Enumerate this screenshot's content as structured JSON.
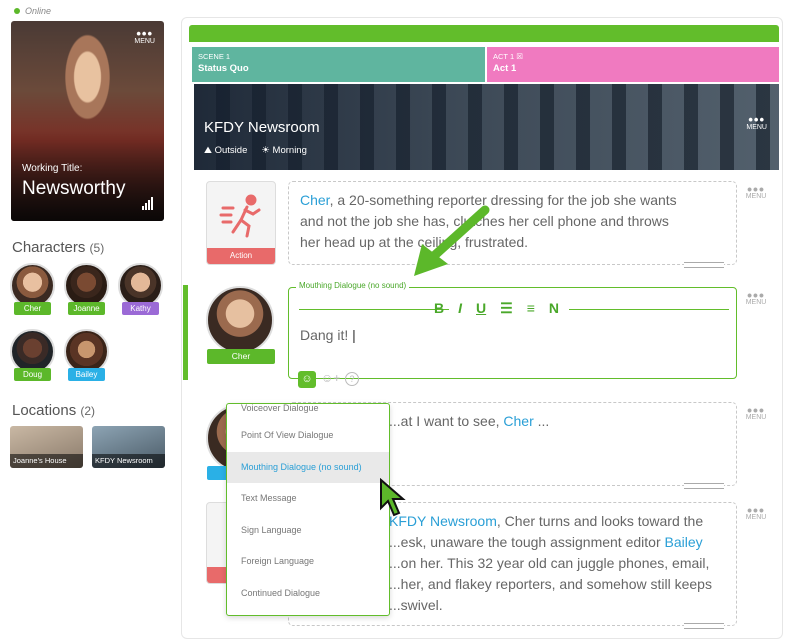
{
  "status": {
    "label": "Online"
  },
  "poster": {
    "menu": "MENU",
    "working_title_label": "Working Title:",
    "title": "Newsworthy"
  },
  "characters": {
    "heading": "Characters",
    "count": "(5)",
    "items": [
      {
        "name": "Cher",
        "color": "#5cb82a"
      },
      {
        "name": "Joanne",
        "color": "#5cb82a"
      },
      {
        "name": "Kathy",
        "color": "#9b6ad6"
      },
      {
        "name": "Doug",
        "color": "#5cb82a"
      },
      {
        "name": "Bailey",
        "color": "#2ab0e6"
      }
    ]
  },
  "locations": {
    "heading": "Locations",
    "count": "(2)",
    "items": [
      {
        "name": "Joanne's House"
      },
      {
        "name": "KFDY Newsroom"
      }
    ]
  },
  "scene": {
    "label": "SCENE 1",
    "name": "Status Quo"
  },
  "act": {
    "label": "ACT 1",
    "name": "Act 1"
  },
  "location_header": {
    "title": "KFDY Newsroom",
    "setting": "Outside",
    "time": "Morning",
    "menu": "MENU"
  },
  "blocks": [
    {
      "type_label": "Action",
      "name_1": "Cher",
      "text_1": ", a 20-something reporter dressing for the job she wants",
      "text_2": "and not the job she has, clutches her cell phone and throws",
      "text_3": "her head up at the ceiling, frustrated."
    },
    {
      "label": "Mouthing Dialogue (no sound)",
      "speaker": "Cher",
      "text": "Dang it!"
    },
    {
      "text_a": "...at I want to see, ",
      "name": "Cher",
      "text_b": " ..."
    },
    {
      "loc": "KFDY Newsroom",
      "text_1": ", Cher turns and looks toward the",
      "text_2": "...esk, unaware the tough assignment editor ",
      "name": "Bailey",
      "text_3": "...on her. This 32 year old can juggle phones, email,",
      "text_4": "...her, and flakey reporters, and somehow still keeps",
      "text_5": "...swivel."
    }
  ],
  "menu_label": "MENU",
  "toolbar": {
    "bold": "B",
    "italic": "I",
    "underline": "U",
    "bullets": "☰",
    "numbers": "≡",
    "n": "N"
  },
  "dropdown": {
    "items": [
      "Voiceover Dialogue",
      "Point Of View Dialogue",
      "Mouthing Dialogue (no sound)",
      "Text Message",
      "Sign Language",
      "Foreign Language",
      "Continued Dialogue"
    ],
    "selected": "Mouthing Dialogue (no sound)"
  }
}
